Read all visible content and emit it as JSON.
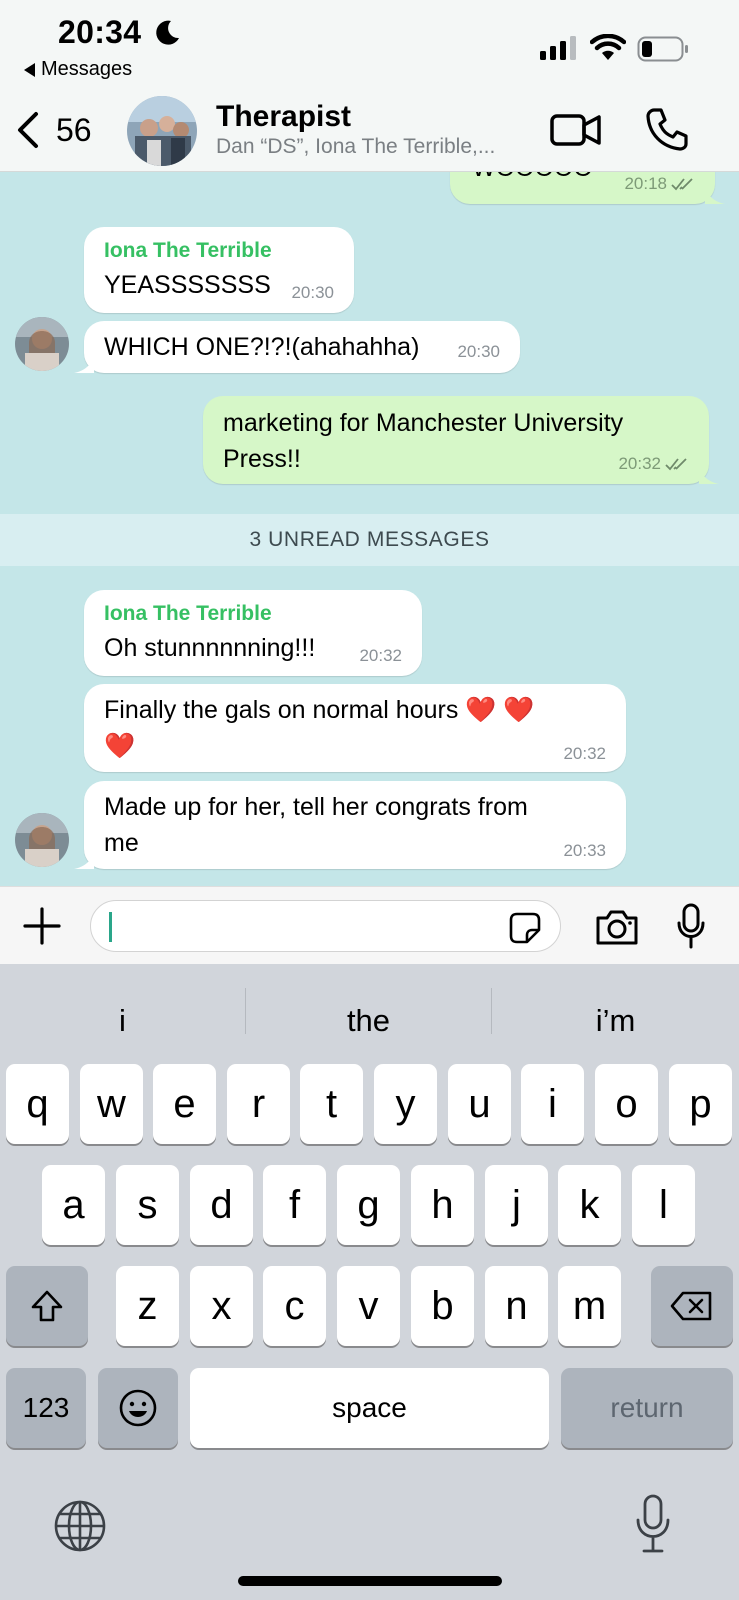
{
  "status_bar": {
    "time": "20:34",
    "back_app": "Messages"
  },
  "header": {
    "back_count": "56",
    "title": "Therapist",
    "subtitle": "Dan “DS”, Iona The Terrible,..."
  },
  "messages": [
    {
      "id": "m0",
      "direction": "out",
      "text": "WOOOOO",
      "time": "20:18"
    },
    {
      "id": "m1",
      "direction": "in",
      "sender": "Iona The Terrible",
      "text": "YEASSSSSSS",
      "time": "20:30"
    },
    {
      "id": "m2",
      "direction": "in",
      "text": "WHICH ONE?!?!(ahahahha)",
      "time": "20:30"
    },
    {
      "id": "m3",
      "direction": "out",
      "text_line1": "marketing for Manchester University",
      "text_line2": "Press!!",
      "time": "20:32"
    },
    {
      "id": "m4",
      "direction": "in",
      "sender": "Iona The Terrible",
      "text": "Oh stunnnnnning!!!",
      "time": "20:32"
    },
    {
      "id": "m5",
      "direction": "in",
      "text_line1": "Finally the gals on normal hours ❤️ ❤️",
      "text_line2": "❤️",
      "time": "20:32"
    },
    {
      "id": "m6",
      "direction": "in",
      "text_line1": "Made up for her, tell her congrats from",
      "text_line2": "me",
      "time": "20:33"
    }
  ],
  "unread_banner": "3 UNREAD MESSAGES",
  "composer": {
    "value": ""
  },
  "keyboard": {
    "suggestions": [
      "i",
      "the",
      "i’m"
    ],
    "row1": [
      "q",
      "w",
      "e",
      "r",
      "t",
      "y",
      "u",
      "i",
      "o",
      "p"
    ],
    "row2": [
      "a",
      "s",
      "d",
      "f",
      "g",
      "h",
      "j",
      "k",
      "l"
    ],
    "row3": [
      "z",
      "x",
      "c",
      "v",
      "b",
      "n",
      "m"
    ],
    "numbers_key": "123",
    "space_key": "space",
    "return_key": "return"
  },
  "colors": {
    "chat_background": "#c4e6e8",
    "outgoing_bubble": "#d6f7c8",
    "sender_name": "#36c063"
  },
  "icons": [
    "moon-icon",
    "signal-icon",
    "wifi-icon",
    "battery-icon",
    "chevron-left-icon",
    "video-camera-icon",
    "phone-icon",
    "plus-icon",
    "sticker-icon",
    "camera-icon",
    "microphone-icon",
    "shift-icon",
    "delete-icon",
    "emoji-icon",
    "globe-icon"
  ]
}
